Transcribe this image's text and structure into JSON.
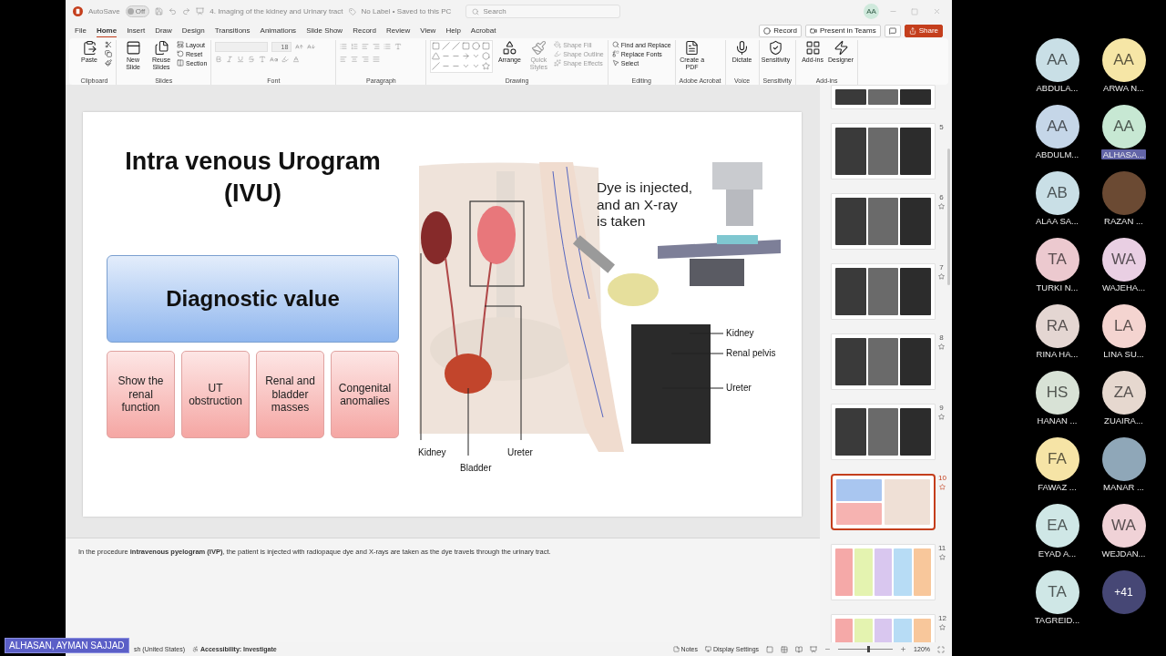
{
  "window": {
    "autosave_label": "AutoSave",
    "autosave_on": false,
    "autosave_state": "Off",
    "title": "4. Imaging of the kidney and Urinary tract",
    "label_status": "No Label • Saved to this PC",
    "search": {
      "placeholder": "Search"
    },
    "account": "AA"
  },
  "menu": {
    "tabs": [
      {
        "label": "File",
        "selected": false
      },
      {
        "label": "Home",
        "selected": true
      },
      {
        "label": "Insert",
        "selected": false
      },
      {
        "label": "Draw",
        "selected": false
      },
      {
        "label": "Design",
        "selected": false
      },
      {
        "label": "Transitions",
        "selected": false
      },
      {
        "label": "Animations",
        "selected": false
      },
      {
        "label": "Slide Show",
        "selected": false
      },
      {
        "label": "Record",
        "selected": false
      },
      {
        "label": "Review",
        "selected": false
      },
      {
        "label": "View",
        "selected": false
      },
      {
        "label": "Help",
        "selected": false
      },
      {
        "label": "Acrobat",
        "selected": false
      }
    ],
    "actions": [
      {
        "kind": "record",
        "label": "Record"
      },
      {
        "kind": "teams",
        "label": "Present in Teams"
      },
      {
        "kind": "comment"
      },
      {
        "kind": "share",
        "label": "Share"
      }
    ]
  },
  "ribbon": {
    "groups": [
      {
        "kind": "clipboard",
        "label": "Clipboard",
        "items": [
          {
            "kind": "large",
            "label": "Paste",
            "disabled": false
          }
        ]
      },
      {
        "kind": "plain",
        "label": "Slides",
        "items": [
          {
            "kind": "large",
            "label": "New Slide",
            "disabled": false
          },
          {
            "kind": "large",
            "label": "Reuse Slides",
            "disabled": false
          },
          {
            "kind": "small",
            "label": "Layout",
            "disabled": false
          },
          {
            "kind": "small",
            "label": "Reset",
            "disabled": false
          },
          {
            "kind": "small",
            "label": "Section",
            "disabled": false
          }
        ]
      },
      {
        "kind": "font",
        "label": "Font",
        "font_size": "18"
      },
      {
        "kind": "paragraph",
        "label": "Paragraph"
      },
      {
        "kind": "drawing",
        "label": "Drawing",
        "items": [
          {
            "kind": "large",
            "label": "Arrange",
            "disabled": false
          },
          {
            "kind": "large",
            "label": "Quick Styles",
            "disabled": true
          },
          {
            "kind": "small",
            "label": "Shape Fill",
            "disabled": true
          },
          {
            "kind": "small",
            "label": "Shape Outline",
            "disabled": true
          },
          {
            "kind": "small",
            "label": "Shape Effects",
            "disabled": true
          }
        ]
      },
      {
        "kind": "plain",
        "label": "Editing",
        "items": [
          {
            "kind": "small",
            "label": "Find and Replace",
            "disabled": false
          },
          {
            "kind": "small",
            "label": "Replace Fonts",
            "disabled": false
          },
          {
            "kind": "small",
            "label": "Select",
            "disabled": false
          }
        ]
      },
      {
        "kind": "plain",
        "label": "Adobe Acrobat",
        "items": [
          {
            "kind": "large",
            "label": "Create a PDF",
            "disabled": false
          }
        ]
      },
      {
        "kind": "plain",
        "label": "Voice",
        "items": [
          {
            "kind": "large",
            "label": "Dictate",
            "disabled": false
          }
        ]
      },
      {
        "kind": "plain",
        "label": "Sensitivity",
        "items": [
          {
            "kind": "large",
            "label": "Sensitivity",
            "disabled": false
          }
        ]
      },
      {
        "kind": "plain",
        "label": "Add-ins",
        "items": [
          {
            "kind": "large",
            "label": "Add-ins",
            "disabled": false
          },
          {
            "kind": "large",
            "label": "Designer",
            "disabled": false
          }
        ]
      }
    ]
  },
  "slide": {
    "title": "Intra venous Urogram (IVU)",
    "heading": "Diagnostic value",
    "values": [
      "Show the renal function",
      "UT obstruction",
      "Renal and bladder masses",
      "Congenital anomalies"
    ],
    "figure": {
      "caption_lines": [
        "Dye is injected,",
        "and an X-ray",
        "is taken"
      ],
      "body_labels": [
        "Kidney",
        "Bladder",
        "Ureter"
      ],
      "xray_labels": [
        "Kidney",
        "Renal pelvis",
        "Ureter"
      ]
    }
  },
  "notes": "In the procedure **intravenous pyelogram (IVP)**, the patient is injected with radiopaque dye and X-rays are taken as the dye travels through the urinary tract.",
  "thumbnails": [
    {
      "kind": "xray",
      "selected": false,
      "star": false
    },
    {
      "kind": "xray",
      "number": "5",
      "selected": false,
      "star": false
    },
    {
      "kind": "xray",
      "number": "6",
      "selected": false,
      "star": true
    },
    {
      "kind": "xray",
      "number": "7",
      "selected": false,
      "star": true
    },
    {
      "kind": "xray",
      "number": "8",
      "selected": false,
      "star": true
    },
    {
      "kind": "xray",
      "number": "9",
      "selected": false,
      "star": true
    },
    {
      "kind": "ivu",
      "number": "10",
      "selected": true,
      "star": true
    },
    {
      "kind": "phases",
      "number": "11",
      "selected": false,
      "star": true
    },
    {
      "kind": "phases",
      "number": "12",
      "selected": false,
      "star": true
    }
  ],
  "status_bar": {
    "language": "sh (United States)",
    "accessibility": "Accessibility: Investigate",
    "notes": "Notes",
    "display": "Display Settings",
    "zoom": "120%",
    "level": 0.55
  },
  "participants": [
    {
      "kind": "initials",
      "initials": "AA",
      "name": "ABDULA...",
      "color": "#c9dfe6",
      "selected": false
    },
    {
      "kind": "initials",
      "initials": "AA",
      "name": "ARWA N...",
      "color": "#f6e6a6",
      "selected": false
    },
    {
      "kind": "initials",
      "initials": "AA",
      "name": "ABDULM...",
      "color": "#c5d6e8",
      "selected": false
    },
    {
      "kind": "initials",
      "initials": "AA",
      "name": "ALHASA...",
      "color": "#c7e8d3",
      "selected": true
    },
    {
      "kind": "initials",
      "initials": "AB",
      "name": "ALAA SA...",
      "color": "#c9dfe6",
      "selected": false
    },
    {
      "kind": "photo",
      "name": "RAZAN ...",
      "color": "#6b4a33",
      "selected": false
    },
    {
      "kind": "initials",
      "initials": "TA",
      "name": "TURKI N...",
      "color": "#ecc9cf",
      "selected": false
    },
    {
      "kind": "initials",
      "initials": "WA",
      "name": "WAJEHA...",
      "color": "#e9cfe3",
      "selected": false
    },
    {
      "kind": "initials",
      "initials": "RA",
      "name": "RINA HA...",
      "color": "#e4d6d2",
      "selected": false
    },
    {
      "kind": "initials",
      "initials": "LA",
      "name": "LINA SU...",
      "color": "#f4d4d0",
      "selected": false
    },
    {
      "kind": "initials",
      "initials": "HS",
      "name": "HANAN ...",
      "color": "#d8e2d6",
      "selected": false
    },
    {
      "kind": "initials",
      "initials": "ZA",
      "name": "ZUAIRA...",
      "color": "#e6d8cf",
      "selected": false
    },
    {
      "kind": "initials",
      "initials": "FA",
      "name": "FAWAZ ...",
      "color": "#f6e4a6",
      "selected": false
    },
    {
      "kind": "photo",
      "name": "MANAR ...",
      "color": "#8fa7b8",
      "selected": false
    },
    {
      "kind": "initials",
      "initials": "EA",
      "name": "EYAD A...",
      "color": "#cfe7e6",
      "selected": false
    },
    {
      "kind": "initials",
      "initials": "WA",
      "name": "WEJDAN...",
      "color": "#f0d2d7",
      "selected": false
    },
    {
      "kind": "initials",
      "initials": "TA",
      "name": "TAGREID...",
      "color": "#cfe7e6",
      "selected": false
    },
    {
      "kind": "more",
      "initials": "+41",
      "color": "#464775"
    }
  ],
  "presenter_tag": "ALHASAN, AYMAN SAJJAD"
}
